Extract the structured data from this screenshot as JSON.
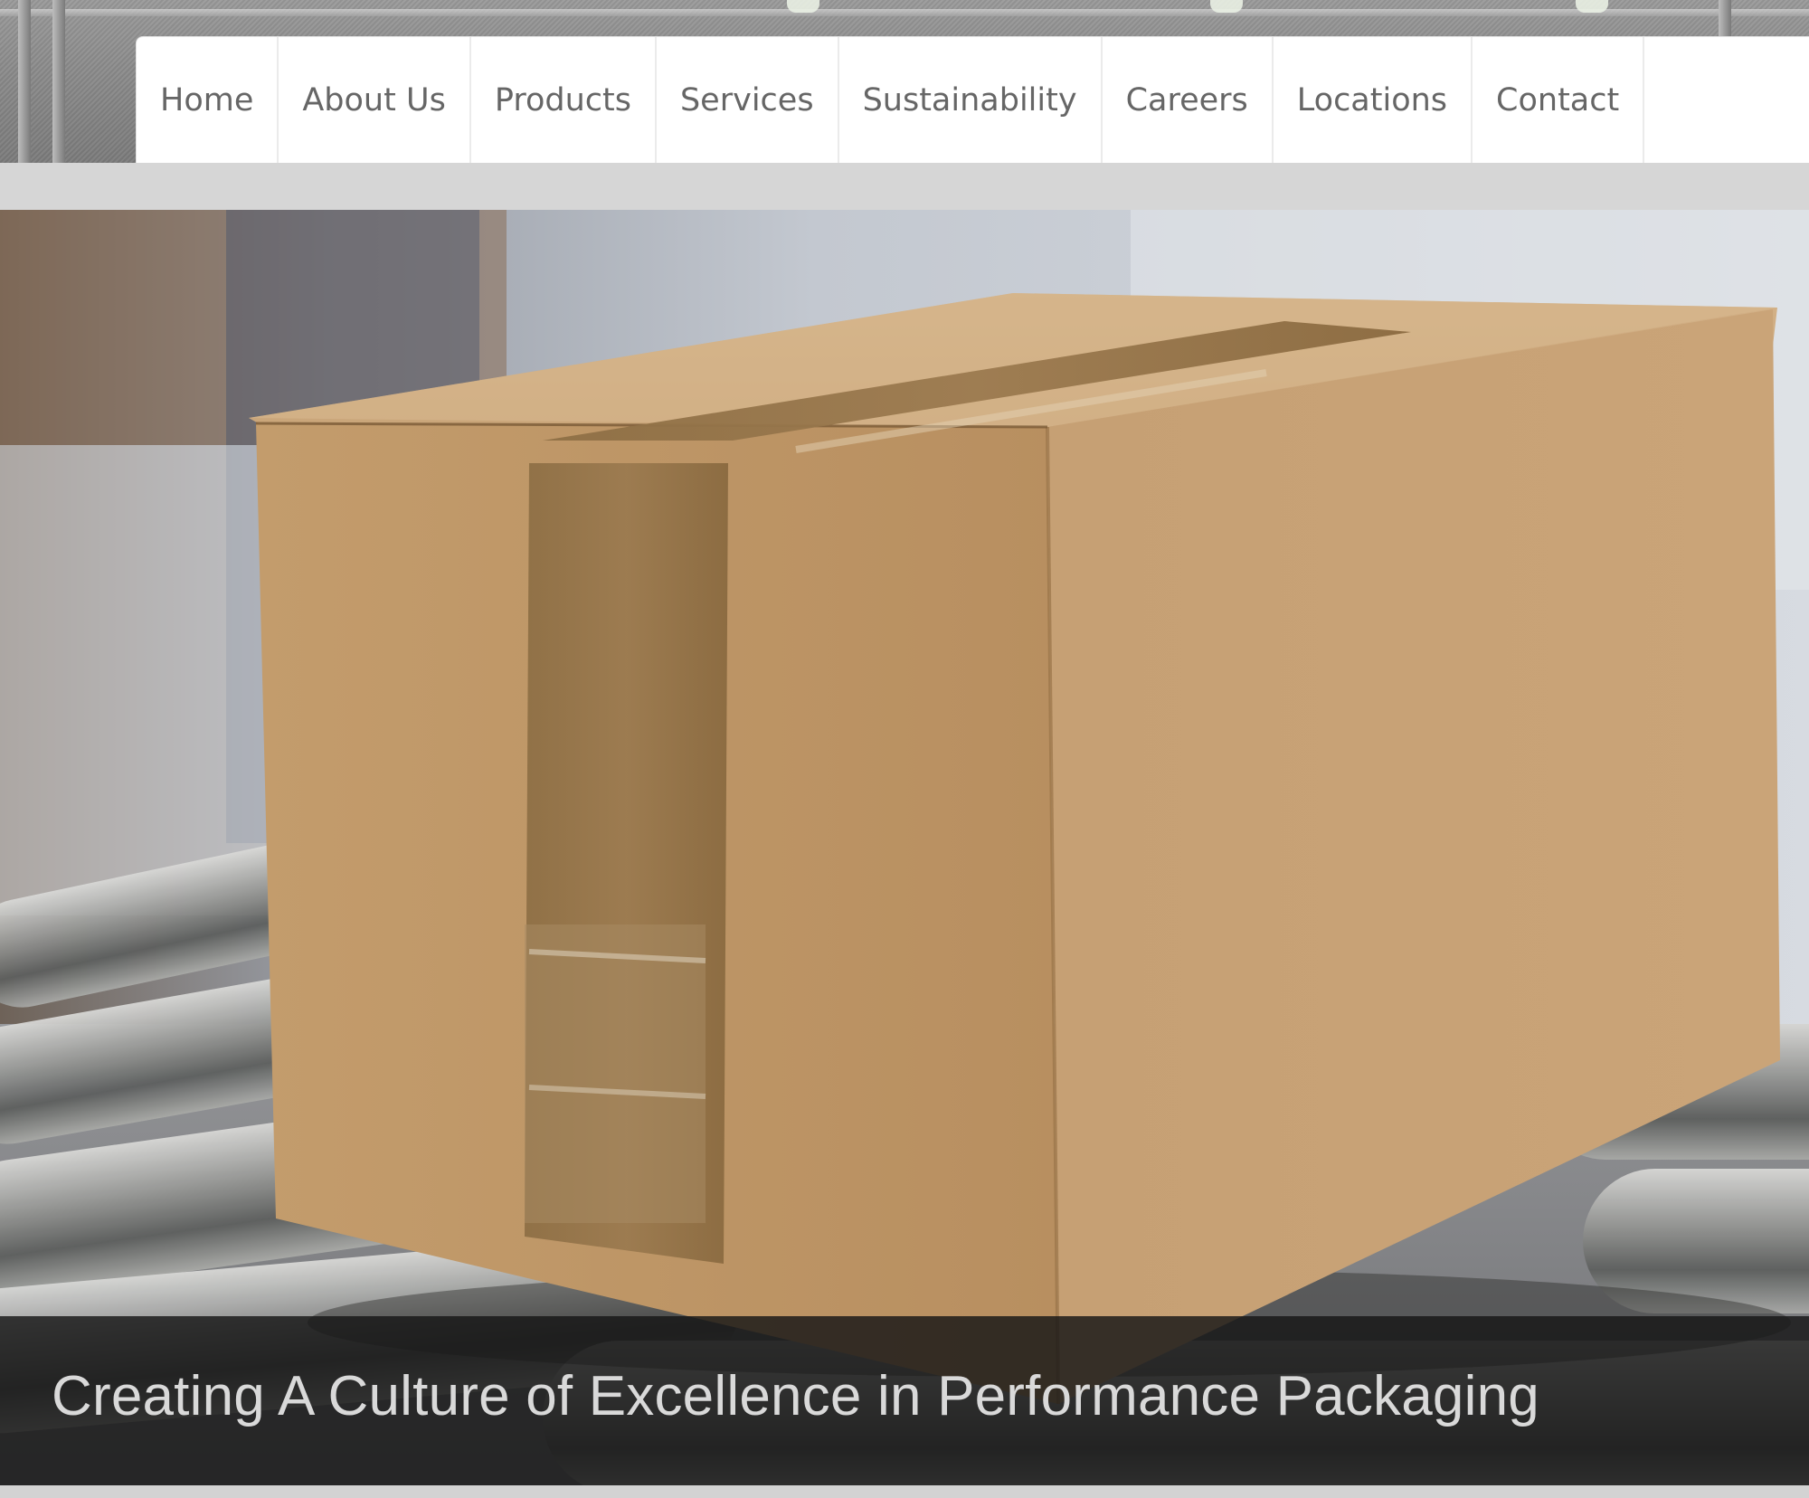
{
  "navigation": {
    "items": [
      {
        "label": "Home"
      },
      {
        "label": "About Us"
      },
      {
        "label": "Products"
      },
      {
        "label": "Services"
      },
      {
        "label": "Sustainability"
      },
      {
        "label": "Careers"
      },
      {
        "label": "Locations"
      },
      {
        "label": "Contact"
      }
    ]
  },
  "hero": {
    "caption": "Creating A Culture of Excellence in Performance Packaging"
  },
  "colors": {
    "nav_background": "#ffffff",
    "nav_text": "#666666",
    "page_background": "#d6d6d6",
    "caption_text": "#d9d9d9",
    "cardboard": "#c69c6a"
  }
}
